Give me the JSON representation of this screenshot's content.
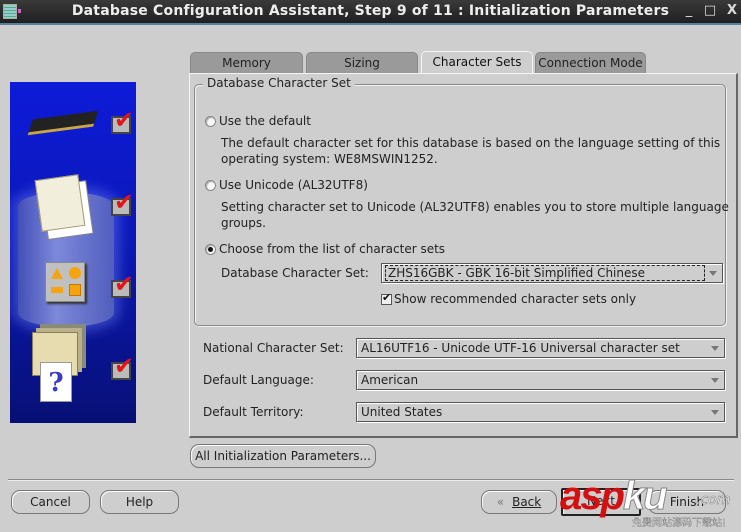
{
  "window": {
    "title": "Database Configuration Assistant, Step 9 of 11 : Initialization Parameters",
    "controls": {
      "minimize": "_",
      "maximize": "□",
      "close": "X"
    }
  },
  "side_panel": {
    "icons": [
      "memory-chip-icon",
      "documents-icon",
      "shapes-icon",
      "help-folders-icon"
    ],
    "steps_completed": [
      true,
      true,
      true,
      true
    ],
    "question_glyph": "?"
  },
  "tabs": [
    {
      "label": "Memory",
      "active": false
    },
    {
      "label": "Sizing",
      "active": false
    },
    {
      "label": "Character Sets",
      "active": true
    },
    {
      "label": "Connection Mode",
      "active": false
    }
  ],
  "db_charset_group": {
    "legend": "Database Character Set",
    "options": [
      {
        "label": "Use the default",
        "selected": false,
        "description_lines": [
          "The default character set for this database is based on the language setting of this",
          "operating system: WE8MSWIN1252."
        ]
      },
      {
        "label": "Use Unicode (AL32UTF8)",
        "selected": false,
        "description_lines": [
          "Setting character set to Unicode (AL32UTF8) enables you to store multiple language",
          "groups."
        ]
      },
      {
        "label": "Choose from the list of character sets",
        "selected": true
      }
    ],
    "db_charset_label": "Database Character Set:",
    "db_charset_value": "ZHS16GBK - GBK 16-bit Simplified Chinese",
    "show_recommended_label": "Show recommended character sets only",
    "show_recommended_checked": true
  },
  "fields": {
    "national_charset_label": "National Character Set:",
    "national_charset_value": "AL16UTF16 - Unicode UTF-16 Universal character set",
    "default_language_label": "Default Language:",
    "default_language_value": "American",
    "default_territory_label": "Default Territory:",
    "default_territory_value": "United States"
  },
  "buttons": {
    "all_params": "All Initialization Parameters...",
    "cancel": "Cancel",
    "help": "Help",
    "back_chevron": "«",
    "back": "Back",
    "next": "Next",
    "finish": "Finish"
  },
  "watermark": {
    "main_prefix": "asp",
    "main_suffix": "ku",
    "domain_suffix": ".com",
    "subtitle": "免费网站源码下载站!"
  }
}
